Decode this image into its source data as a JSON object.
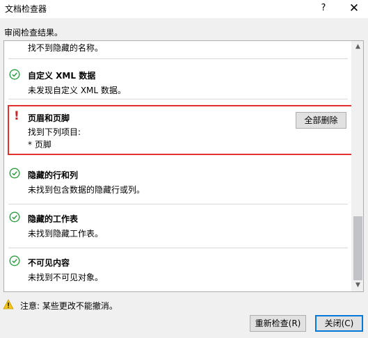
{
  "window": {
    "title": "文档检查器",
    "help_glyph": "?",
    "close_glyph": "✕"
  },
  "subtitle": "审阅检查结果。",
  "items": [
    {
      "name": "",
      "description": "找不到隐藏的名称。",
      "status": "ok"
    },
    {
      "name": "自定义 XML 数据",
      "description": "未发现自定义 XML 数据。",
      "status": "ok"
    },
    {
      "name": "页眉和页脚",
      "description_lines": [
        "找到下列项目:",
        "* 页脚"
      ],
      "status": "warning",
      "action_label": "全部删除"
    },
    {
      "name": "隐藏的行和列",
      "description": "未找到包含数据的隐藏行或列。",
      "status": "ok"
    },
    {
      "name": "隐藏的工作表",
      "description": "未找到隐藏工作表。",
      "status": "ok"
    },
    {
      "name": "不可见内容",
      "description": "未找到不可见对象。",
      "status": "ok"
    }
  ],
  "warning_mark": "!",
  "footer_note": "注意: 某些更改不能撤消。",
  "buttons": {
    "recheck": "重新检查(R)",
    "close": "关闭(C)"
  },
  "scroll": {
    "up_glyph": "▲",
    "down_glyph": "▼"
  },
  "colors": {
    "ok": "#2e9e3e",
    "highlight_border": "#e0312f",
    "warning": "#c62828",
    "default_button_border": "#0078d7"
  },
  "icons": {
    "ok": "check-circle-icon",
    "warning": "exclamation-icon",
    "footer": "warning-triangle-icon"
  }
}
